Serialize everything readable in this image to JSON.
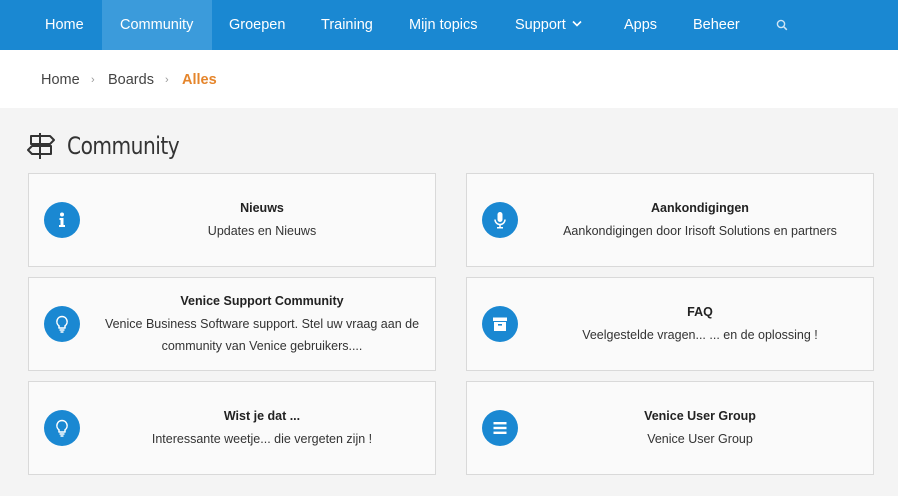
{
  "nav": {
    "items": [
      {
        "label": "Home"
      },
      {
        "label": "Community"
      },
      {
        "label": "Groepen"
      },
      {
        "label": "Training"
      },
      {
        "label": "Mijn topics"
      },
      {
        "label": "Support"
      },
      {
        "label": "Apps"
      },
      {
        "label": "Beheer"
      }
    ],
    "active": "Community",
    "search_icon": "search-icon",
    "accent_color": "#1a88d2"
  },
  "breadcrumb": {
    "items": [
      {
        "label": "Home"
      },
      {
        "label": "Boards"
      },
      {
        "label": "Alles"
      }
    ],
    "separator": "›",
    "current_color": "#e5852b"
  },
  "page": {
    "title": "Community",
    "title_icon": "signpost-icon"
  },
  "boards": [
    {
      "title": "Nieuws",
      "description": "Updates en Nieuws",
      "icon": "info-icon"
    },
    {
      "title": "Aankondigingen",
      "description": "Aankondigingen door Irisoft Solutions en partners",
      "icon": "microphone-icon"
    },
    {
      "title": "Venice Support Community",
      "description": "Venice Business Software support. Stel uw vraag aan de community van Venice gebruikers....",
      "icon": "lightbulb-icon"
    },
    {
      "title": "FAQ",
      "description": "Veelgestelde vragen... ... en de oplossing !",
      "icon": "archive-icon"
    },
    {
      "title": "Wist je dat ...",
      "description": "Interessante weetje... die vergeten zijn !",
      "icon": "lightbulb-icon"
    },
    {
      "title": "Venice User Group",
      "description": "Venice User Group",
      "icon": "list-icon"
    }
  ]
}
